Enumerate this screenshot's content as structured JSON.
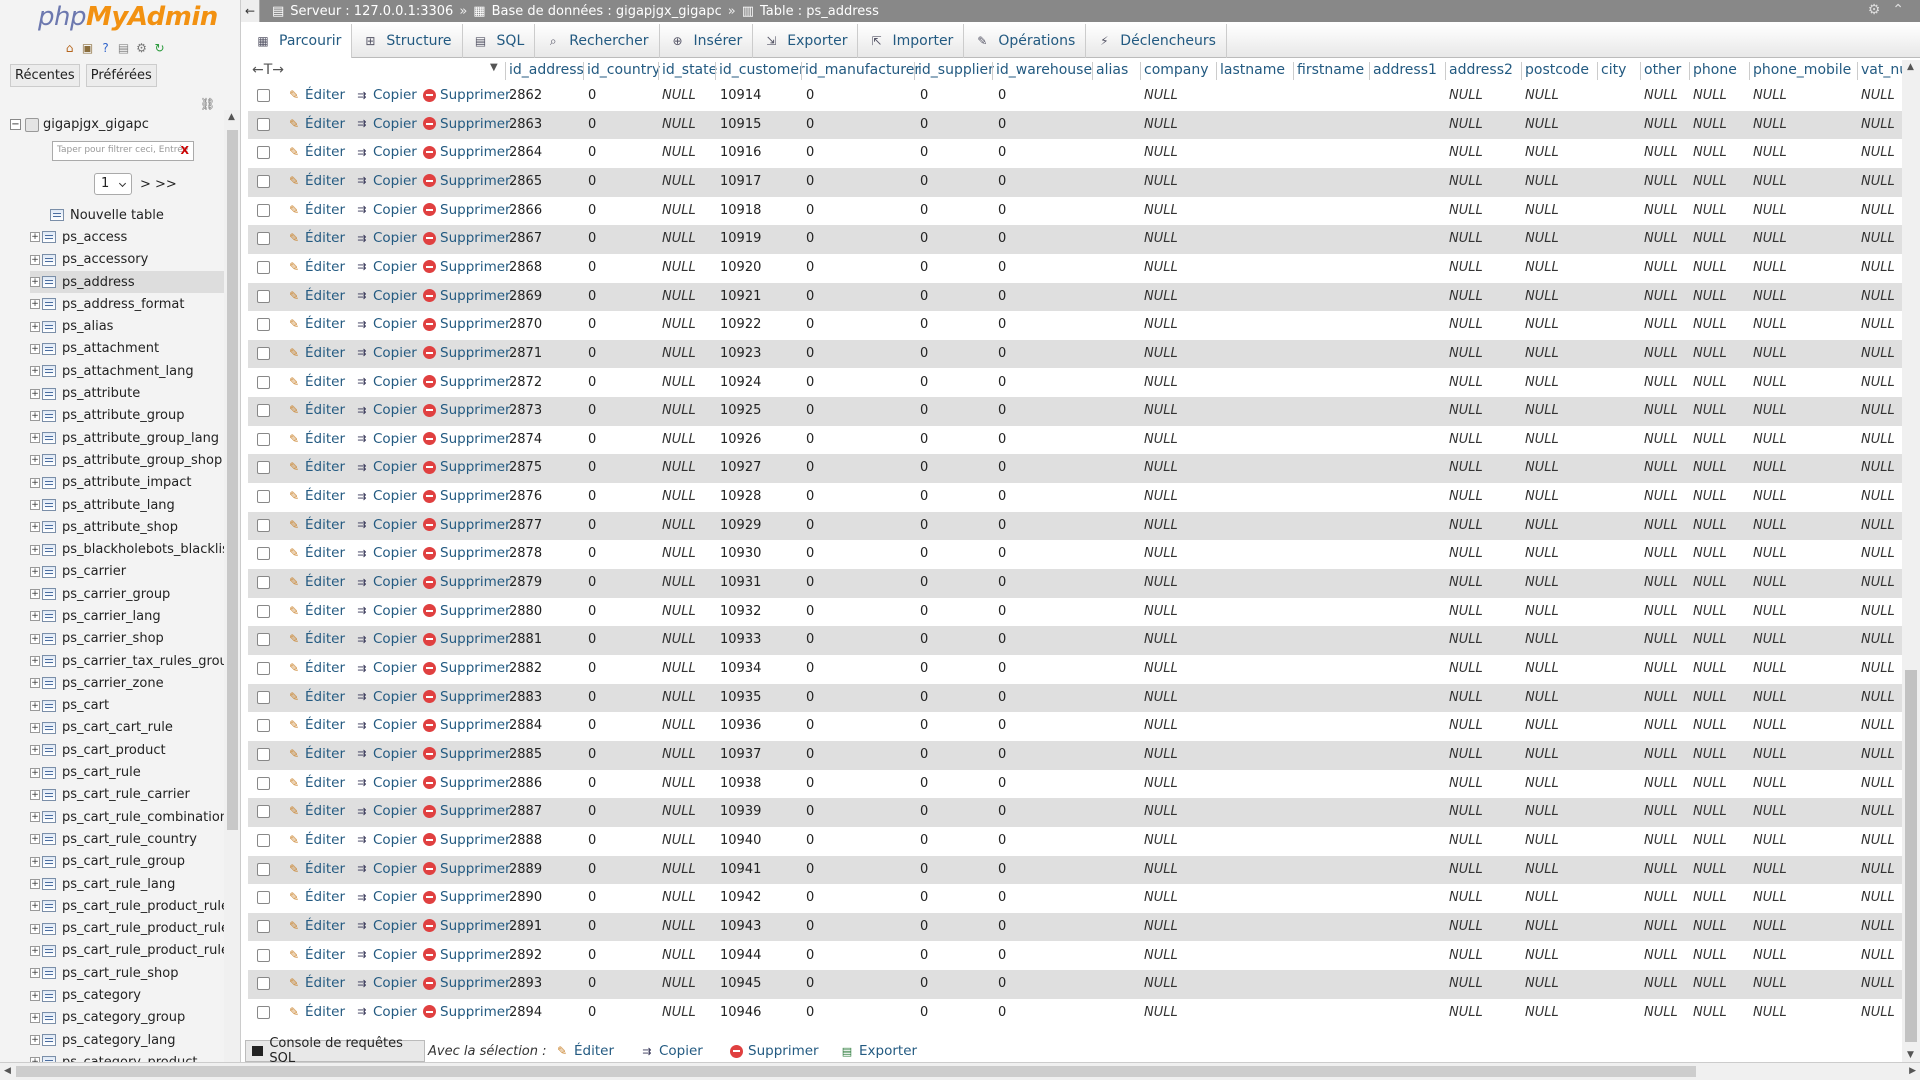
{
  "app": {
    "logo_php": "php",
    "logo_myadmin": "MyAdmin"
  },
  "nav": {
    "tabs": [
      "Récentes",
      "Préférées"
    ],
    "database": "gigapjgx_gigapc",
    "filter_placeholder": "Taper pour filtrer ceci, Entrée",
    "filter_clear": "X",
    "page_value": "1",
    "page_more": "> >>",
    "new_table": "Nouvelle table",
    "tables": [
      "ps_access",
      "ps_accessory",
      "ps_address",
      "ps_address_format",
      "ps_alias",
      "ps_attachment",
      "ps_attachment_lang",
      "ps_attribute",
      "ps_attribute_group",
      "ps_attribute_group_lang",
      "ps_attribute_group_shop",
      "ps_attribute_impact",
      "ps_attribute_lang",
      "ps_attribute_shop",
      "ps_blackholebots_blacklist",
      "ps_carrier",
      "ps_carrier_group",
      "ps_carrier_lang",
      "ps_carrier_shop",
      "ps_carrier_tax_rules_group",
      "ps_carrier_zone",
      "ps_cart",
      "ps_cart_cart_rule",
      "ps_cart_product",
      "ps_cart_rule",
      "ps_cart_rule_carrier",
      "ps_cart_rule_combination",
      "ps_cart_rule_country",
      "ps_cart_rule_group",
      "ps_cart_rule_lang",
      "ps_cart_rule_product_rule",
      "ps_cart_rule_product_rule_",
      "ps_cart_rule_product_rule_",
      "ps_cart_rule_shop",
      "ps_category",
      "ps_category_group",
      "ps_category_lang",
      "ps_category_product"
    ],
    "selected_table": "ps_address"
  },
  "breadcrumb": {
    "server": "Serveur : 127.0.0.1:3306",
    "database": "Base de données : gigapjgx_gigapc",
    "table": "Table : ps_address",
    "sep": "»"
  },
  "menu": [
    "Parcourir",
    "Structure",
    "SQL",
    "Rechercher",
    "Insérer",
    "Exporter",
    "Importer",
    "Opérations",
    "Déclencheurs"
  ],
  "grid": {
    "nav_arrows": "←T→",
    "columns": [
      "id_address",
      "id_country",
      "id_state",
      "id_customer",
      "id_manufacturer",
      "id_supplier",
      "id_warehouse",
      "alias",
      "company",
      "lastname",
      "firstname",
      "address1",
      "address2",
      "postcode",
      "city",
      "other",
      "phone",
      "phone_mobile",
      "vat_nu"
    ],
    "action_edit": "Éditer",
    "action_copy": "Copier",
    "action_delete": "Supprimer",
    "null_text": "NULL",
    "rows": [
      {
        "id_address": "2862",
        "id_customer": "10914"
      },
      {
        "id_address": "2863",
        "id_customer": "10915"
      },
      {
        "id_address": "2864",
        "id_customer": "10916"
      },
      {
        "id_address": "2865",
        "id_customer": "10917"
      },
      {
        "id_address": "2866",
        "id_customer": "10918"
      },
      {
        "id_address": "2867",
        "id_customer": "10919"
      },
      {
        "id_address": "2868",
        "id_customer": "10920"
      },
      {
        "id_address": "2869",
        "id_customer": "10921"
      },
      {
        "id_address": "2870",
        "id_customer": "10922"
      },
      {
        "id_address": "2871",
        "id_customer": "10923"
      },
      {
        "id_address": "2872",
        "id_customer": "10924"
      },
      {
        "id_address": "2873",
        "id_customer": "10925"
      },
      {
        "id_address": "2874",
        "id_customer": "10926"
      },
      {
        "id_address": "2875",
        "id_customer": "10927"
      },
      {
        "id_address": "2876",
        "id_customer": "10928"
      },
      {
        "id_address": "2877",
        "id_customer": "10929"
      },
      {
        "id_address": "2878",
        "id_customer": "10930"
      },
      {
        "id_address": "2879",
        "id_customer": "10931"
      },
      {
        "id_address": "2880",
        "id_customer": "10932"
      },
      {
        "id_address": "2881",
        "id_customer": "10933"
      },
      {
        "id_address": "2882",
        "id_customer": "10934"
      },
      {
        "id_address": "2883",
        "id_customer": "10935"
      },
      {
        "id_address": "2884",
        "id_customer": "10936"
      },
      {
        "id_address": "2885",
        "id_customer": "10937"
      },
      {
        "id_address": "2886",
        "id_customer": "10938"
      },
      {
        "id_address": "2887",
        "id_customer": "10939"
      },
      {
        "id_address": "2888",
        "id_customer": "10940"
      },
      {
        "id_address": "2889",
        "id_customer": "10941"
      },
      {
        "id_address": "2890",
        "id_customer": "10942"
      },
      {
        "id_address": "2891",
        "id_customer": "10943"
      },
      {
        "id_address": "2892",
        "id_customer": "10944"
      },
      {
        "id_address": "2893",
        "id_customer": "10945"
      },
      {
        "id_address": "2894",
        "id_customer": "10946"
      }
    ],
    "row_common": {
      "id_country": "0",
      "id_state": "NULL",
      "id_manufacturer": "0",
      "id_supplier": "0",
      "id_warehouse": "0",
      "company": "NULL",
      "address2": "NULL",
      "postcode": "NULL",
      "other": "NULL",
      "phone": "NULL",
      "phone_mobile": "NULL",
      "vat_nu": "NULL"
    }
  },
  "bottom": {
    "console": "Console de requêtes SQL",
    "with_selection": "Avec la sélection :",
    "actions": [
      "Éditer",
      "Copier",
      "Supprimer",
      "Exporter"
    ]
  }
}
